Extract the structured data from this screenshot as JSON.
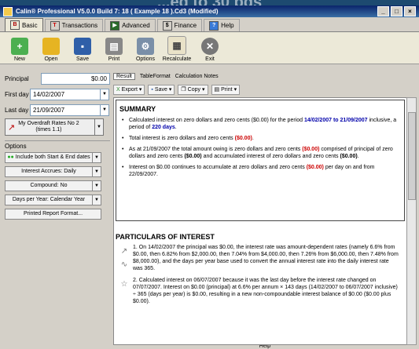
{
  "banner": "...ed to 30 bds",
  "window": {
    "title": "Calin® Professional V5.0.0 Build 7: 18 ( Example 18 ).Cd3 (Modified)"
  },
  "menu": {
    "tabs": [
      {
        "label": "Basic",
        "icon": "B"
      },
      {
        "label": "Transactions",
        "icon": "T"
      },
      {
        "label": "Advanced",
        "icon": "▶"
      },
      {
        "label": "Finance",
        "icon": "$"
      },
      {
        "label": "Help",
        "icon": "?"
      }
    ]
  },
  "toolbar": {
    "new": "New",
    "open": "Open",
    "save": "Save",
    "print": "Print",
    "options": "Options",
    "recalculate": "Recalculate",
    "help": "Help",
    "exit": "Exit"
  },
  "form": {
    "principal_label": "Principal",
    "principal_value": "$0.00",
    "first_day_label": "First day",
    "first_day_value": "14/02/2007",
    "last_day_label": "Last day",
    "last_day_value": "21/09/2007",
    "rates_line1": "My Overdraft Rates No 2",
    "rates_line2": "(times 1.1)"
  },
  "options": {
    "heading": "Options",
    "buttons": [
      "Include both Start & End dates",
      "Interest Accrues: Daily",
      "Compound: No",
      "Days per Year: Calendar Year",
      "Printed Report Format..."
    ]
  },
  "result_tabs": [
    "Result",
    "TableFormat",
    "Calculation Notes"
  ],
  "result_tools": [
    "Export",
    "Save",
    "Copy",
    "Print"
  ],
  "summary": {
    "heading": "SUMMARY",
    "b1_pre": "Calculated interest on zero dollars and zero cents ($0.00) for the period ",
    "b1_period": "14/02/2007 to 21/09/2007",
    "b1_mid": " inclusive, a period of ",
    "b1_days": "220 days",
    "b1_end": ".",
    "b2_pre": "Total interest is zero dollars and zero cents ",
    "b2_val": "($0.00)",
    "b2_end": ".",
    "b3_pre": "As at 21/09/2007 the total amount owing is zero dollars and zero cents ",
    "b3_val1": "($0.00)",
    "b3_mid1": " comprised of principal of zero dollars and zero cents ",
    "b3_val2": "($0.00)",
    "b3_mid2": " and accumulated interest of zero dollars and zero cents ",
    "b3_val3": "($0.00)",
    "b3_end": ".",
    "b4_pre": "Interest on $0.00 continues to accumulate at zero dollars and zero cents ",
    "b4_val": "($0.00)",
    "b4_end": " per day on and from 22/09/2007."
  },
  "particulars": {
    "heading": "PARTICULARS OF INTEREST",
    "items": [
      "1. On 14/02/2007 the principal was $0.00, the interest rate was amount-dependent rates (namely 6.6% from $0.00, then 6.82% from $2,000.00, then 7.04% from $4,000.00, then 7.26% from $6,000.00, then 7.48% from $8,000.00), and the days per year base used to convert the annual interest rate into the daily interest rate was 365.",
      "2. Calculated interest on 06/07/2007 because it was the last day before the interest rate changed on 07/07/2007. Interest on $0.00 (principal) at 6.6% per annum × 143 days (14/02/2007 to 06/07/2007 inclusive) ÷ 365 (days per year) is $0.00, resulting in a new non-compoundable interest balance of $0.00 ($0.00 plus $0.00)."
    ]
  }
}
